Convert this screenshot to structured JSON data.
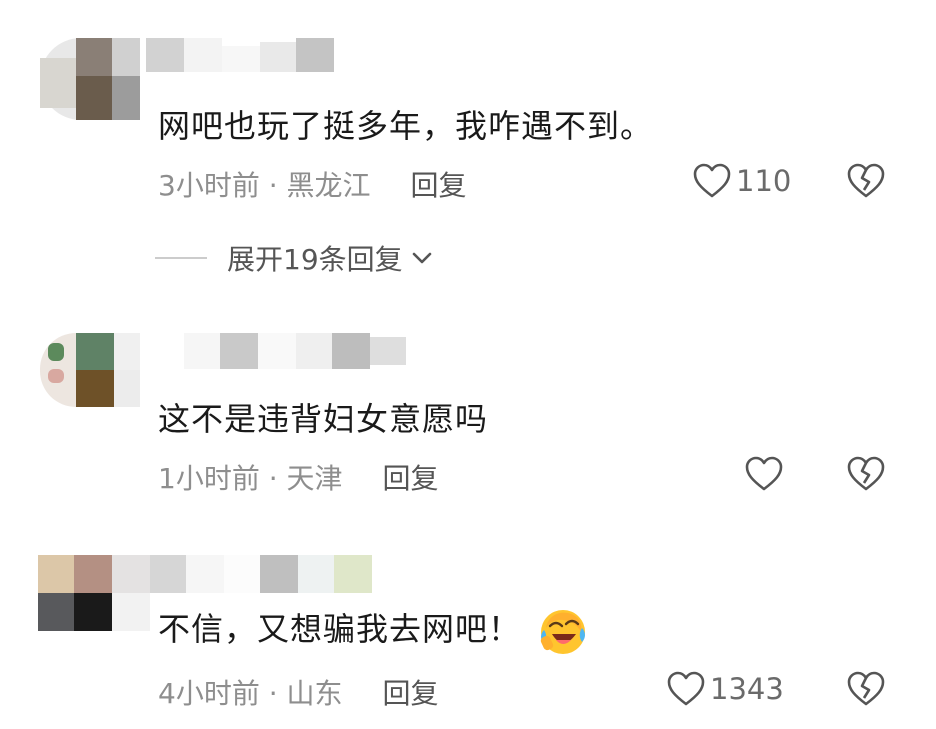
{
  "comments": [
    {
      "text": "网吧也玩了挺多年，我咋遇不到。",
      "time": "3小时前",
      "location": "黑龙江",
      "reply_label": "回复",
      "likes": "110",
      "like_icon": "heart-outline-icon",
      "dislike_icon": "broken-heart-icon"
    },
    {
      "text": "这不是违背妇女意愿吗",
      "time": "1小时前",
      "location": "天津",
      "reply_label": "回复",
      "likes": "",
      "like_icon": "heart-outline-icon",
      "dislike_icon": "broken-heart-icon"
    },
    {
      "text": "不信，又想骗我去网吧！",
      "time": "4小时前",
      "location": "山东",
      "reply_label": "回复",
      "likes": "1343",
      "like_icon": "heart-outline-icon",
      "dislike_icon": "broken-heart-icon",
      "emoji": "laughing-crying-emoji"
    }
  ],
  "expand_replies": "展开19条回复",
  "meta_separator": " · "
}
